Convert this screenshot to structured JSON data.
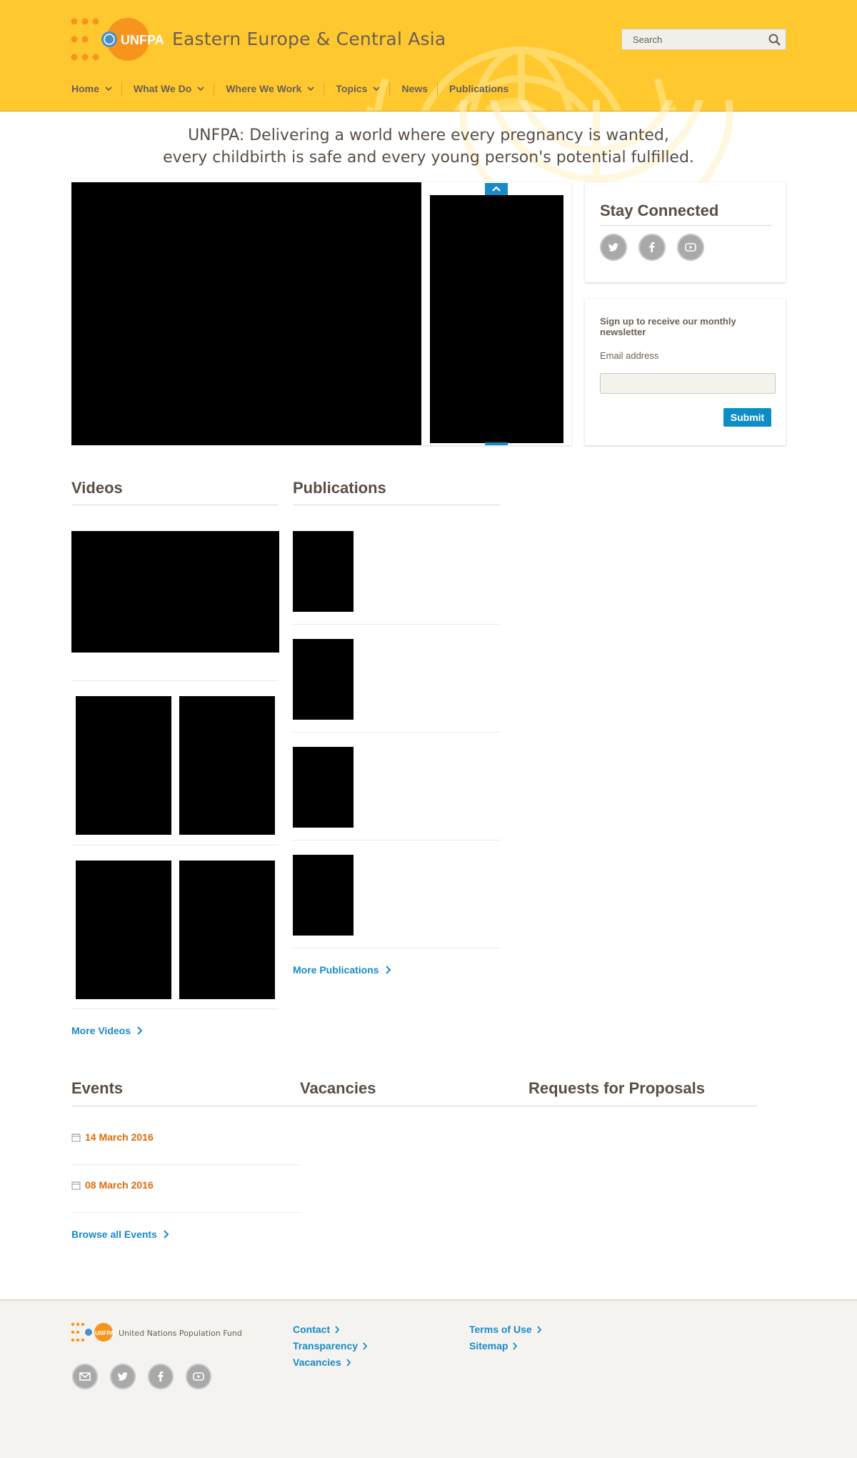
{
  "header": {
    "site_title": "Eastern Europe & Central Asia",
    "logo_text": "UNFPA",
    "search_placeholder": "Search",
    "brand_color": "#ffc82e"
  },
  "nav": {
    "items": [
      {
        "label": "Home",
        "has_dropdown": true
      },
      {
        "label": "What We Do",
        "has_dropdown": true
      },
      {
        "label": "Where We Work",
        "has_dropdown": true
      },
      {
        "label": "Topics",
        "has_dropdown": true
      },
      {
        "label": "News",
        "has_dropdown": false
      },
      {
        "label": "Publications",
        "has_dropdown": false
      }
    ]
  },
  "tagline": {
    "line1": "UNFPA: Delivering a world where every pregnancy is wanted,",
    "line2": "every childbirth is safe and every young person's potential fulfilled."
  },
  "sidebar": {
    "stay_connected": {
      "title": "Stay Connected",
      "icons": [
        "twitter-icon",
        "facebook-icon",
        "youtube-icon"
      ]
    },
    "newsletter": {
      "title": "Sign up to receive our monthly newsletter",
      "email_label": "Email address",
      "email_value": "",
      "submit_label": "Submit"
    }
  },
  "videos": {
    "heading": "Videos",
    "more_label": "More Videos"
  },
  "publications": {
    "heading": "Publications",
    "more_label": "More Publications"
  },
  "lower": {
    "events_heading": "Events",
    "vacancies_heading": "Vacancies",
    "rfp_heading": "Requests for Proposals",
    "events": [
      {
        "date": "14 March 2016"
      },
      {
        "date": "08 March 2016"
      }
    ],
    "browse_label": "Browse all Events"
  },
  "footer": {
    "org_name": "United Nations Population Fund",
    "logo_text": "UNFPA",
    "links_col1": [
      "Contact",
      "Transparency",
      "Vacancies"
    ],
    "links_col2": [
      "Terms of Use",
      "Sitemap"
    ],
    "social_icons": [
      "email-icon",
      "twitter-icon",
      "facebook-icon",
      "youtube-icon"
    ]
  },
  "colors": {
    "accent_blue": "#1a8ac6",
    "event_orange": "#e16a0a",
    "text_brown": "#5a4e44"
  }
}
